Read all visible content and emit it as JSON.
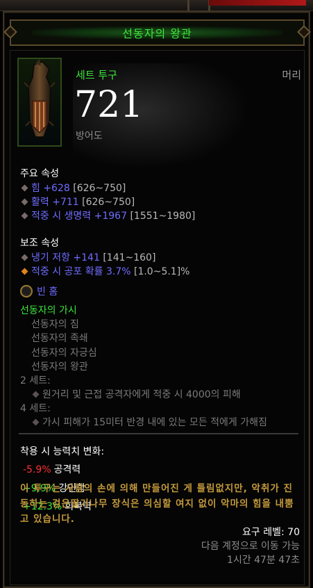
{
  "item": {
    "name": "선동자의 왕관",
    "set_type": "세트 투구",
    "slot": "머리",
    "armor": "721",
    "armor_label": "방어도"
  },
  "primary": {
    "title": "주요 속성",
    "attrs": [
      {
        "name": "힘 +628",
        "range": " [626~750]"
      },
      {
        "name": "활력 +711",
        "range": " [626~750]"
      },
      {
        "name": "적중 시 생명력 +1967",
        "range": " [1551~1980]"
      }
    ]
  },
  "secondary": {
    "title": "보조 속성",
    "attrs": [
      {
        "name": "냉기 저항 +141",
        "range": " [141~160]"
      },
      {
        "name": "적중 시 공포 확률 3.7%",
        "range": " [1.0~5.1]%"
      }
    ]
  },
  "socket": {
    "label": "빈 홈"
  },
  "set": {
    "name": "선동자의 가시",
    "pieces": [
      "선동자의 짐",
      "선동자의 족쇄",
      "선동자의 자긍심",
      "선동자의 왕관"
    ],
    "bonus2_label": "2 세트:",
    "bonus2": "원거리 및 근접 공격자에게 적중 시 4000의 피해",
    "bonus4_label": "4 세트:",
    "bonus4": "가시 피해가 15미터 반경 내에 있는 모든 적에게 가해짐"
  },
  "stat_change": {
    "title": "착용 시 능력치 변화:",
    "rows": [
      {
        "value": "-5.9%",
        "name": "공격력",
        "kind": "neg"
      },
      {
        "value": "+9.9%",
        "name": "강인함",
        "kind": "pos"
      },
      {
        "value": "+12.3%",
        "name": "회복력",
        "kind": "pos"
      }
    ]
  },
  "flavor": "이 투구는 사람의 손에 의해 만들어진 게 틀림없지만, 악취가 진동하는 검은딸기나무 장식은 의심할 여지 없이 악마의 힘을 내뿜고 있습니다.",
  "footer": {
    "required_level": "요구 레벨: 70",
    "account_bound": "다음 계정으로 이동 가능",
    "timer": "1시간 47분 47초"
  },
  "colors": {
    "set_green": "#3ce63c",
    "magic_blue": "#6f6cff",
    "flavor_gold": "#c49a3c",
    "negative_red": "#ff3030"
  }
}
